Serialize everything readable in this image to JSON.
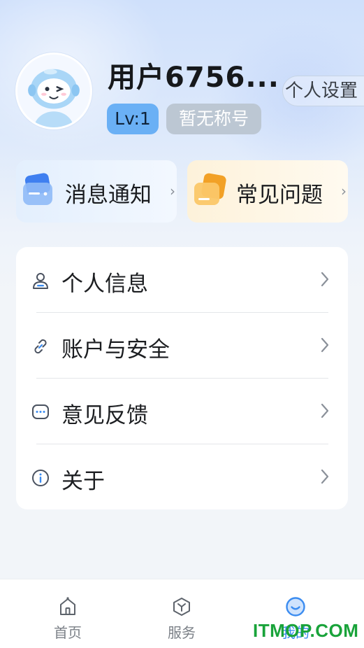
{
  "profile": {
    "username": "用户6756...",
    "level": "Lv:1",
    "title": "暂无称号",
    "settings_label": "个人设置"
  },
  "quick_cards": [
    {
      "label": "消息通知",
      "icon": "message-bell-icon",
      "arrow": "›"
    },
    {
      "label": "常见问题",
      "icon": "faq-cards-icon",
      "arrow": "›"
    }
  ],
  "menu": {
    "items": [
      {
        "label": "个人信息",
        "icon": "person-icon"
      },
      {
        "label": "账户与安全",
        "icon": "link-icon"
      },
      {
        "label": "意见反馈",
        "icon": "chat-bubble-icon"
      },
      {
        "label": "关于",
        "icon": "info-icon"
      }
    ]
  },
  "bottom_nav": [
    {
      "label": "首页",
      "icon": "home-icon",
      "active": false
    },
    {
      "label": "服务",
      "icon": "service-cube-icon",
      "active": false
    },
    {
      "label": "我的",
      "icon": "mine-face-icon",
      "active": true
    }
  ],
  "watermark": "ITMOP.COM",
  "colors": {
    "accent": "#3b8cf0",
    "level_badge": "#6ab0f5",
    "title_badge": "#bcc7d3",
    "watermark": "#19a33a"
  }
}
